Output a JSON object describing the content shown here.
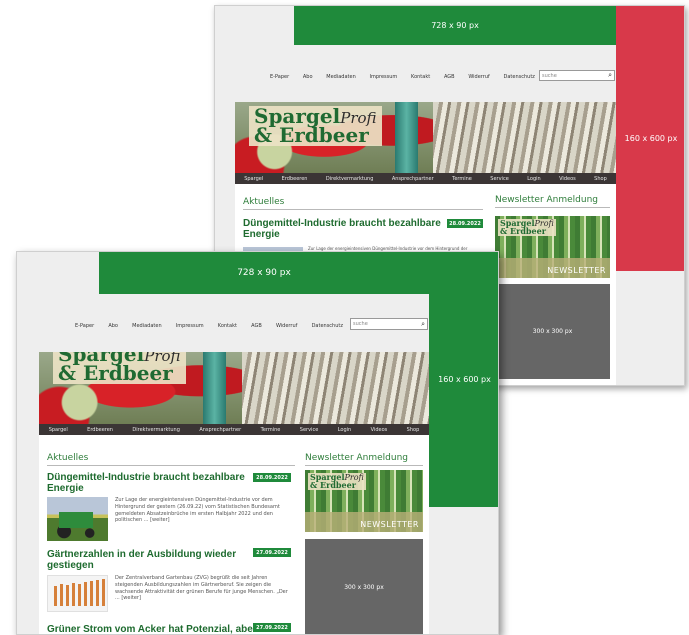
{
  "ads": {
    "leaderboard": "728 x 90 px",
    "skyscraper": "160 x 600 px",
    "rectangle": "300 x 300 px"
  },
  "nav": {
    "items": [
      "E-Paper",
      "Abo",
      "Mediadaten",
      "Impressum",
      "Kontakt",
      "AGB",
      "Widerruf",
      "Datenschutz"
    ],
    "search_placeholder": "suche",
    "search_icon": "magnifier-icon"
  },
  "logo": {
    "line1": "Spargel",
    "profi": "Profi",
    "line2": "& Erdbeer"
  },
  "menu": [
    "Spargel",
    "Erdbeeren",
    "Direktvermarktung",
    "Ansprechpartner",
    "Termine",
    "Service",
    "Login",
    "Videos",
    "Shop"
  ],
  "sections": {
    "aktuelles": "Aktuelles",
    "newsletter": "Newsletter Anmeldung",
    "newsletter_banner": "NEWSLETTER"
  },
  "articles": [
    {
      "title": "Düngemittel-Industrie braucht bezahlbare Energie",
      "date": "28.09.2022",
      "teaser": "Zur Lage der energieintensiven Düngemittel-Industrie vor dem Hintergrund der gestern (26.09.22) vom Statistischen Bundesamt gemeldeten Absatzeinbrüche im ersten Halbjahr 2022 und den politischen ... [weiter]"
    },
    {
      "title": "Gärtnerzahlen in der Ausbildung wieder gestiegen",
      "date": "27.09.2022",
      "teaser": "Der Zentralverband Gartenbau (ZVG) begrüßt die seit Jahren steigenden Ausbildungszahlen im Gärtnerberuf. Sie zeigen die wachsende Attraktivität der grünen Berufe für junge Menschen. „Der ... [weiter]"
    },
    {
      "title": "Grüner Strom vom Acker hat Potenzial, aber",
      "date": "27.09.2022"
    }
  ],
  "colors": {
    "brand_green": "#1f8a3b",
    "ad_red": "#d8394a",
    "menu_bar": "#3b3535",
    "placeholder_gray": "#666666"
  }
}
